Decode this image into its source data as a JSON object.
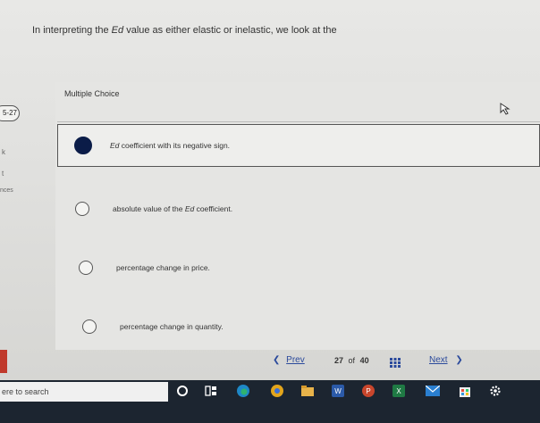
{
  "question": {
    "prefix": "In interpreting the ",
    "term": "Ed",
    "suffix": " value as either elastic or inelastic, we look at the"
  },
  "sidebar": {
    "badge": "5-27",
    "item1": "k",
    "item2": "t",
    "item3": "nces"
  },
  "main": {
    "type_label": "Multiple Choice",
    "options": [
      {
        "pre": "",
        "term": "Ed",
        "post": " coefficient with its negative sign.",
        "selected": true
      },
      {
        "pre": "absolute value of the ",
        "term": "Ed",
        "post": " coefficient.",
        "selected": false
      },
      {
        "pre": "percentage change in price.",
        "term": "",
        "post": "",
        "selected": false
      },
      {
        "pre": "percentage change in quantity.",
        "term": "",
        "post": "",
        "selected": false
      }
    ]
  },
  "footer": {
    "prev_label": "Prev",
    "current": "27",
    "of_label": "of",
    "total": "40",
    "next_label": "Next"
  },
  "taskbar": {
    "search_placeholder": "ere to search",
    "icons": [
      "cortana-icon",
      "task-view-icon",
      "edge-icon",
      "chrome-icon",
      "file-explorer-icon",
      "word-icon",
      "powerpoint-icon",
      "excel-icon",
      "mail-icon",
      "store-icon",
      "settings-icon"
    ]
  },
  "colors": {
    "selected_radio": "#0b1c48",
    "link": "#2b4a9c",
    "taskbar": "#1c2530"
  }
}
